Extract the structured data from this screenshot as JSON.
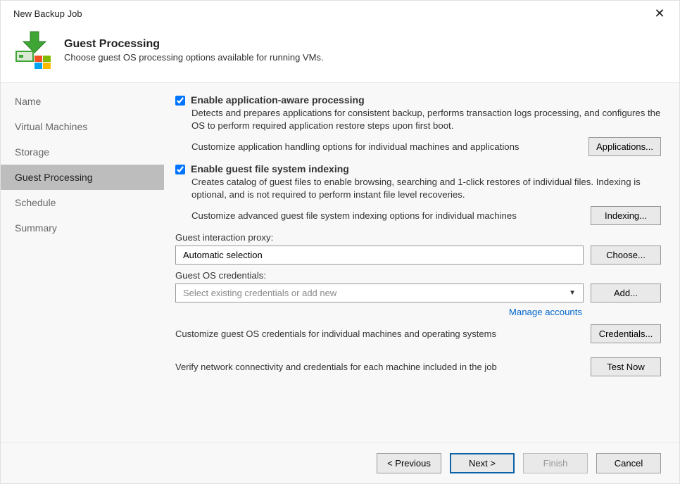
{
  "window": {
    "title": "New Backup Job"
  },
  "header": {
    "title": "Guest Processing",
    "subtitle": "Choose guest OS processing options available for running VMs."
  },
  "sidebar": {
    "items": [
      {
        "label": "Name"
      },
      {
        "label": "Virtual Machines"
      },
      {
        "label": "Storage"
      },
      {
        "label": "Guest Processing"
      },
      {
        "label": "Schedule"
      },
      {
        "label": "Summary"
      }
    ]
  },
  "app_aware": {
    "label": "Enable application-aware processing",
    "desc": "Detects and prepares applications for consistent backup, performs transaction logs processing, and configures the OS to perform required application restore steps upon first boot.",
    "customize": "Customize application handling options for individual machines and applications",
    "btn": "Applications..."
  },
  "indexing": {
    "label": "Enable guest file system indexing",
    "desc": "Creates catalog of guest files to enable browsing, searching and 1-click restores of individual files. Indexing is optional, and is not required to perform instant file level recoveries.",
    "customize": "Customize advanced guest file system indexing options for individual machines",
    "btn": "Indexing..."
  },
  "proxy": {
    "label": "Guest interaction proxy:",
    "value": "Automatic selection",
    "btn": "Choose..."
  },
  "creds": {
    "label": "Guest OS credentials:",
    "placeholder": "Select existing credentials or add new",
    "btn": "Add...",
    "link": "Manage accounts",
    "customize": "Customize guest OS credentials for individual machines and operating systems",
    "customize_btn": "Credentials..."
  },
  "verify": {
    "label": "Verify network connectivity and credentials for each machine included in the job",
    "btn": "Test Now"
  },
  "footer": {
    "previous": "< Previous",
    "next": "Next >",
    "finish": "Finish",
    "cancel": "Cancel"
  }
}
